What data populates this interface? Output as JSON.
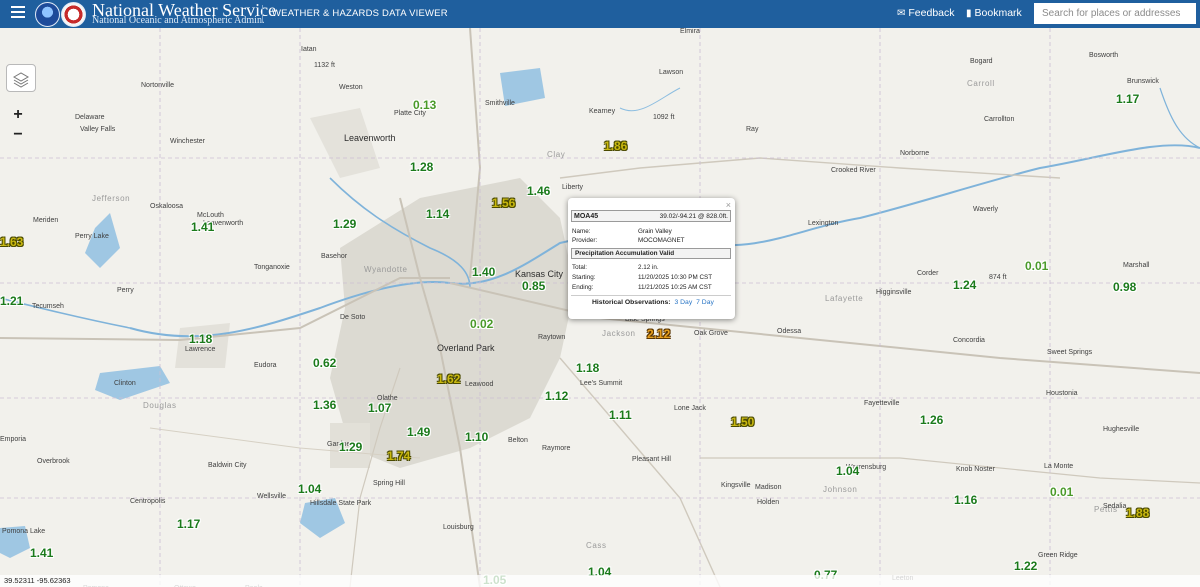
{
  "header": {
    "menu_icon": "hamburger-menu-icon",
    "site_title": "National Weather Service",
    "site_subtitle": "National Oceanic and Atmospheric Admin.",
    "viewer_title": "WEATHER & HAZARDS DATA VIEWER",
    "feedback_label": "Feedback",
    "feedback_icon": "envelope-icon",
    "bookmark_label": "Bookmark",
    "bookmark_icon": "bookmark-icon",
    "search_placeholder": "Search for places or addresses"
  },
  "controls": {
    "layers_icon": "layers-icon",
    "zoom_in": "+",
    "zoom_out": "−"
  },
  "places": [
    {
      "name": "Elmira"
    },
    {
      "name": "Iatan"
    },
    {
      "name": "1132 ft"
    },
    {
      "name": "Nortonville"
    },
    {
      "name": "Weston"
    },
    {
      "name": "Lawson"
    },
    {
      "name": "Bogard"
    },
    {
      "name": "Bosworth"
    },
    {
      "name": "Carroll"
    },
    {
      "name": "Brunswick"
    },
    {
      "name": "Delaware"
    },
    {
      "name": "Valley Falls"
    },
    {
      "name": "Platte City"
    },
    {
      "name": "Smithville"
    },
    {
      "name": "Kearney"
    },
    {
      "name": "1092 ft"
    },
    {
      "name": "Ray"
    },
    {
      "name": "Carrollton"
    },
    {
      "name": "Winchester"
    },
    {
      "name": "Leavenworth"
    },
    {
      "name": "Clay"
    },
    {
      "name": "Norborne"
    },
    {
      "name": "Crooked River"
    },
    {
      "name": "Liberty"
    },
    {
      "name": "Jefferson"
    },
    {
      "name": "Oskaloosa"
    },
    {
      "name": "McLouth"
    },
    {
      "name": "Waverly"
    },
    {
      "name": "Meriden"
    },
    {
      "name": "Perry Lake"
    },
    {
      "name": "Leavenworth"
    },
    {
      "name": "Lexington"
    },
    {
      "name": "Basehor"
    },
    {
      "name": "Wyandotte"
    },
    {
      "name": "Kansas City"
    },
    {
      "name": "Tonganoxie"
    },
    {
      "name": "Corder"
    },
    {
      "name": "874 ft"
    },
    {
      "name": "Marshall"
    },
    {
      "name": "Perry"
    },
    {
      "name": "Lafayette"
    },
    {
      "name": "Higginsville"
    },
    {
      "name": "Tecumseh"
    },
    {
      "name": "De Soto"
    },
    {
      "name": "Raytown"
    },
    {
      "name": "Blue Springs"
    },
    {
      "name": "Jackson"
    },
    {
      "name": "Oak Grove"
    },
    {
      "name": "Odessa"
    },
    {
      "name": "Lawrence"
    },
    {
      "name": "Overland Park"
    },
    {
      "name": "Concordia"
    },
    {
      "name": "Sweet Springs"
    },
    {
      "name": "Eudora"
    },
    {
      "name": "Lee's Summit"
    },
    {
      "name": "Leawood"
    },
    {
      "name": "Clinton"
    },
    {
      "name": "Olathe"
    },
    {
      "name": "Douglas"
    },
    {
      "name": "Lone Jack"
    },
    {
      "name": "Fayetteville"
    },
    {
      "name": "Houstonia"
    },
    {
      "name": "Belton"
    },
    {
      "name": "Hughesville"
    },
    {
      "name": "Gardner"
    },
    {
      "name": "Raymore"
    },
    {
      "name": "Pleasant Hill"
    },
    {
      "name": "Warrensburg"
    },
    {
      "name": "Knob Noster"
    },
    {
      "name": "La Monte"
    },
    {
      "name": "Overbrook"
    },
    {
      "name": "Baldwin City"
    },
    {
      "name": "Kingsville"
    },
    {
      "name": "Madison"
    },
    {
      "name": "Johnson"
    },
    {
      "name": "Spring Hill"
    },
    {
      "name": "Holden"
    },
    {
      "name": "Wellsville"
    },
    {
      "name": "Centropolis"
    },
    {
      "name": "Pettis"
    },
    {
      "name": "Sedalia"
    },
    {
      "name": "Hillsdale State Park"
    },
    {
      "name": "Pomona Lake"
    },
    {
      "name": "Louisburg"
    },
    {
      "name": "Cass"
    },
    {
      "name": "Green Ridge"
    },
    {
      "name": "Pomona"
    },
    {
      "name": "Ottawa"
    },
    {
      "name": "Paola"
    },
    {
      "name": "Leeton"
    },
    {
      "name": "Emporia"
    }
  ],
  "observations": [
    {
      "v": "0.13",
      "c": "#4a9a2a"
    },
    {
      "v": "1.86",
      "c": "#c9b80f"
    },
    {
      "v": "1.17",
      "c": "#1b7a1b"
    },
    {
      "v": "1.28",
      "c": "#1b7a1b"
    },
    {
      "v": "1.46",
      "c": "#1b7a1b"
    },
    {
      "v": "1.56",
      "c": "#c9b80f"
    },
    {
      "v": "1.14",
      "c": "#1b7a1b"
    },
    {
      "v": "1.29",
      "c": "#1b7a1b"
    },
    {
      "v": "1.41",
      "c": "#1b7a1b"
    },
    {
      "v": "1.63",
      "c": "#c9b80f"
    },
    {
      "v": "1.40",
      "c": "#1b7a1b"
    },
    {
      "v": "0.85",
      "c": "#1b7a1b"
    },
    {
      "v": "1.24",
      "c": "#1b7a1b"
    },
    {
      "v": "0.01",
      "c": "#4a9a2a"
    },
    {
      "v": "0.98",
      "c": "#1b7a1b"
    },
    {
      "v": "1.21",
      "c": "#1b7a1b"
    },
    {
      "v": "0.02",
      "c": "#4a9a2a"
    },
    {
      "v": "1.18",
      "c": "#1b7a1b"
    },
    {
      "v": "0.62",
      "c": "#1b7a1b"
    },
    {
      "v": "1.62",
      "c": "#c9b80f"
    },
    {
      "v": "2.12",
      "c": "#e7a01e"
    },
    {
      "v": "1.18",
      "c": "#1b7a1b"
    },
    {
      "v": "1.36",
      "c": "#1b7a1b"
    },
    {
      "v": "1.07",
      "c": "#1b7a1b"
    },
    {
      "v": "1.12",
      "c": "#1b7a1b"
    },
    {
      "v": "1.11",
      "c": "#1b7a1b"
    },
    {
      "v": "1.50",
      "c": "#c9b80f"
    },
    {
      "v": "1.26",
      "c": "#1b7a1b"
    },
    {
      "v": "1.49",
      "c": "#1b7a1b"
    },
    {
      "v": "1.10",
      "c": "#1b7a1b"
    },
    {
      "v": "1.29",
      "c": "#1b7a1b"
    },
    {
      "v": "1.74",
      "c": "#c9b80f"
    },
    {
      "v": "1.04",
      "c": "#1b7a1b"
    },
    {
      "v": "1.04",
      "c": "#1b7a1b"
    },
    {
      "v": "1.16",
      "c": "#1b7a1b"
    },
    {
      "v": "0.01",
      "c": "#4a9a2a"
    },
    {
      "v": "1.88",
      "c": "#c9b80f"
    },
    {
      "v": "1.17",
      "c": "#1b7a1b"
    },
    {
      "v": "1.41",
      "c": "#1b7a1b"
    },
    {
      "v": "1.05",
      "c": "#1b7a1b"
    },
    {
      "v": "1.04",
      "c": "#1b7a1b"
    },
    {
      "v": "0.77",
      "c": "#1b7a1b"
    },
    {
      "v": "1.22",
      "c": "#1b7a1b"
    }
  ],
  "popup": {
    "station_id": "MOA45",
    "coords": "39.02/-94.21 @ 828.0ft.",
    "name_label": "Name:",
    "name_value": "Grain Valley",
    "provider_label": "Provider:",
    "provider_value": "MOCOMAGNET",
    "section_title": "Precipitation Accumulation Valid",
    "total_label": "Total:",
    "total_value": "2.12 in.",
    "starting_label": "Starting:",
    "starting_value": "11/20/2025 10:30 PM CST",
    "ending_label": "Ending:",
    "ending_value": "11/21/2025 10:25 AM CST",
    "historical_label": "Historical Observations:",
    "link_3day": "3 Day",
    "link_7day": "7 Day",
    "close": "×"
  },
  "status": {
    "coords": "39.52311  -95.62363"
  }
}
